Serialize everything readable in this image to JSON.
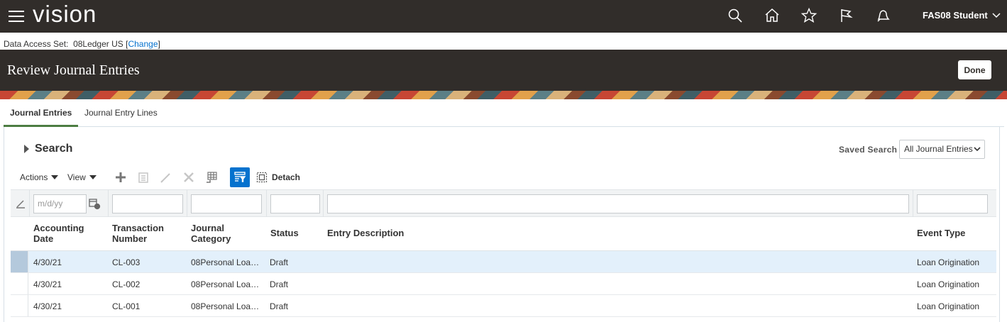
{
  "topbar": {
    "logo": "vision",
    "user": "FAS08 Student",
    "icons": [
      "search-icon",
      "home-icon",
      "star-icon",
      "flag-icon",
      "bell-icon"
    ]
  },
  "das": {
    "label": "Data Access Set:",
    "value": "08Ledger US",
    "change": "Change"
  },
  "header": {
    "title": "Review Journal Entries",
    "done": "Done"
  },
  "tabs": [
    {
      "label": "Journal Entries",
      "active": true
    },
    {
      "label": "Journal Entry Lines",
      "active": false
    }
  ],
  "search": {
    "label": "Search",
    "saved_label": "Saved Search",
    "saved_value": "All Journal Entries"
  },
  "toolbar": {
    "actions": "Actions",
    "view": "View",
    "detach": "Detach"
  },
  "filters": {
    "date_placeholder": "m/d/yy"
  },
  "columns": [
    {
      "line1": "Accounting",
      "line2": "Date"
    },
    {
      "line1": "Transaction",
      "line2": "Number"
    },
    {
      "line1": "Journal",
      "line2": "Category"
    },
    {
      "line1": "Status",
      "line2": ""
    },
    {
      "line1": "Entry Description",
      "line2": ""
    },
    {
      "line1": "Event Type",
      "line2": ""
    }
  ],
  "rows": [
    {
      "date": "4/30/21",
      "number": "CL-003",
      "category": "08Personal Loa…",
      "status": "Draft",
      "description": "",
      "event": "Loan Origination",
      "selected": true
    },
    {
      "date": "4/30/21",
      "number": "CL-002",
      "category": "08Personal Loa…",
      "status": "Draft",
      "description": "",
      "event": "Loan Origination",
      "selected": false
    },
    {
      "date": "4/30/21",
      "number": "CL-001",
      "category": "08Personal Loa…",
      "status": "Draft",
      "description": "",
      "event": "Loan Origination",
      "selected": false
    }
  ]
}
